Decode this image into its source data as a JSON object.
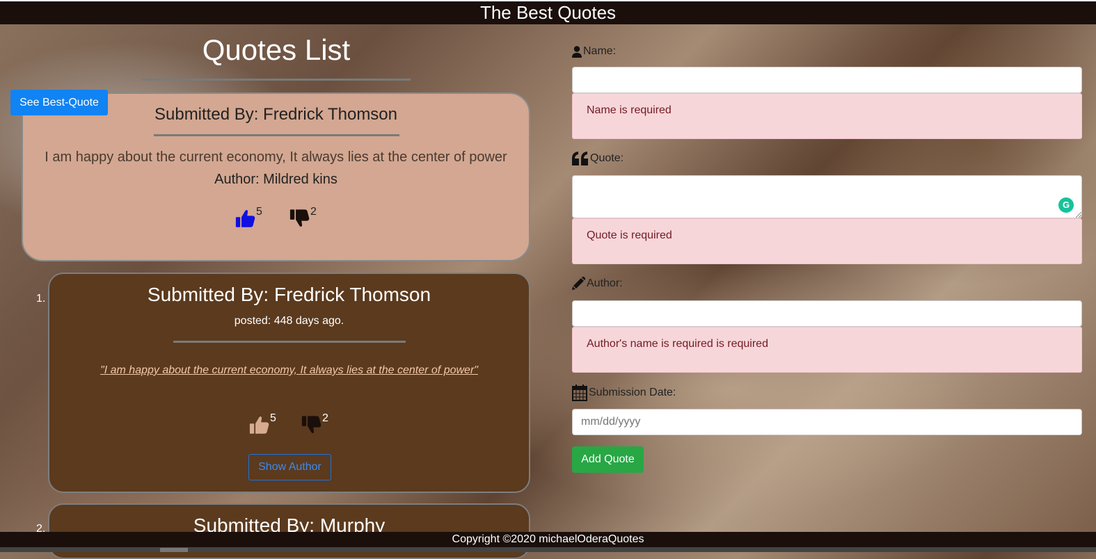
{
  "header": {
    "title": "The Best Quotes"
  },
  "quotes_list": {
    "title": "Quotes List"
  },
  "best_quote_button": "See Best-Quote",
  "best_quote": {
    "submitted_by": "Submitted By: Fredrick Thomson",
    "quote": "I am happy about the current economy, It always lies at the center of power",
    "author": "Author: Mildred kins",
    "upvotes": "5",
    "downvotes": "2"
  },
  "quotes": [
    {
      "number": "1.",
      "submitted_by": "Submitted By: Fredrick Thomson",
      "posted": "posted: 448 days ago.",
      "quote": "\"I am happy about the current economy, It always lies at the center of power\"",
      "upvotes": "5",
      "downvotes": "2",
      "show_author_label": "Show Author"
    },
    {
      "number": "2.",
      "submitted_by": "Submitted By: Murphy"
    }
  ],
  "form": {
    "name": {
      "label": "Name:",
      "value": "",
      "error": "Name is required"
    },
    "quote": {
      "label": "Quote:",
      "value": "",
      "error": "Quote is required"
    },
    "author": {
      "label": "Author:",
      "value": "",
      "error": "Author's name is required is required"
    },
    "date": {
      "label": "Submission Date:",
      "placeholder": "mm/dd/yyyy"
    },
    "submit_label": "Add Quote",
    "grammarly_badge": "G"
  },
  "footer": {
    "copyright": "Copyright ©2020 michaelOderaQuotes"
  },
  "colors": {
    "header_bg": "#1a0f0b",
    "best_card_bg": "#d3a791",
    "quote_card_bg": "#5b3a1e",
    "primary": "#1183f3",
    "success": "#28a745",
    "alert_bg": "#f7d6da",
    "upvote_active": "#1010e0"
  },
  "icons": [
    "user-icon",
    "quote-left-icon",
    "pencil-icon",
    "calendar-icon",
    "thumbs-up-icon",
    "thumbs-down-icon",
    "grammarly-icon"
  ]
}
